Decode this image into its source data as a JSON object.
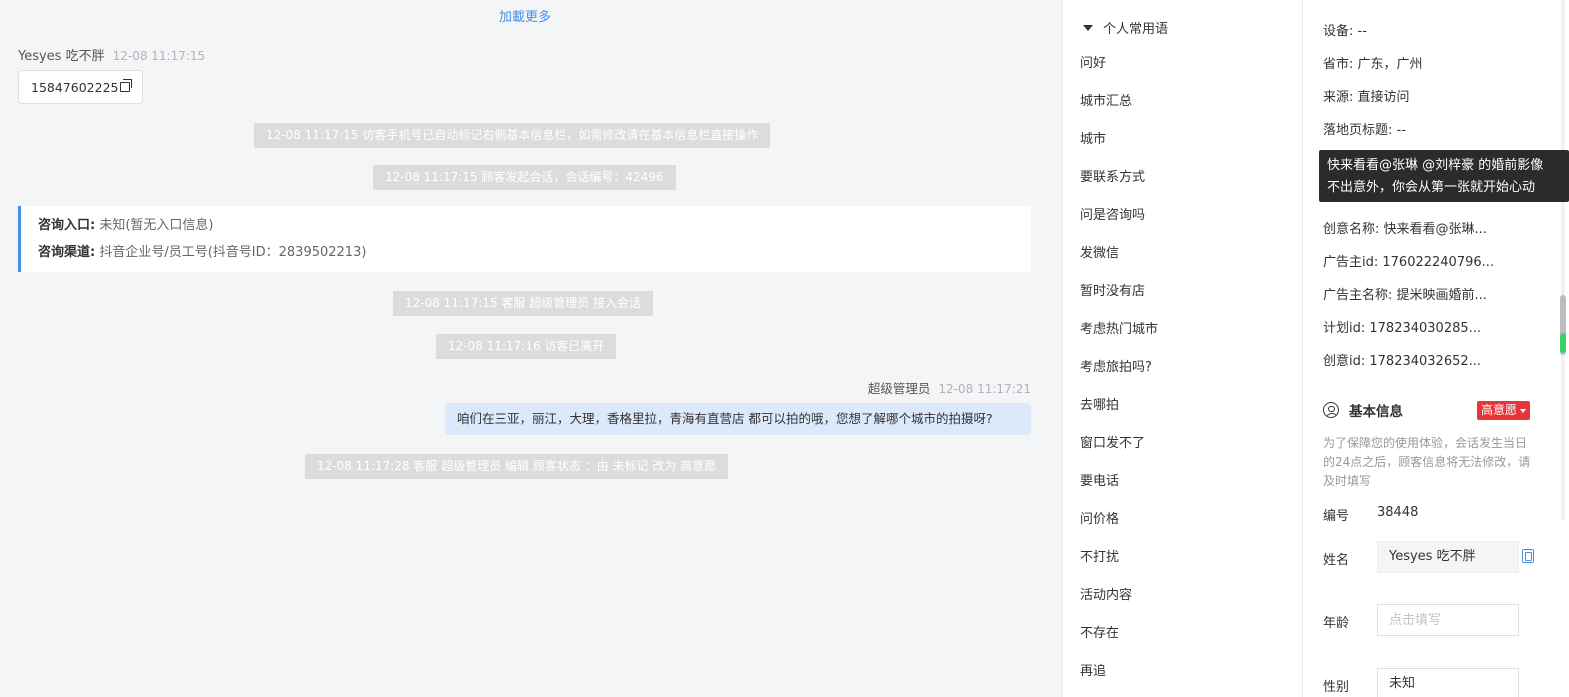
{
  "chat": {
    "load_more": "加載更多",
    "first_msg": {
      "sender": "Yesyes 吃不胖",
      "time": "12-08 11:17:15",
      "content": "15847602225"
    },
    "system_msgs": [
      "12-08 11:17:15 访客手机号已自动标记右侧基本信息栏，如需修改请在基本信息栏直接操作",
      "12-08 11:17:15 顾客发起会话，会话编号：42496",
      "12-08 11:17:15 客服 超级管理员 接入会话",
      "12-08 11:17:16 访客已离开",
      "12-08 11:17:28 客服 超级管理员 编辑 顾客状态 ：由 未标记 改为 高意愿"
    ],
    "consult": {
      "entry_label": "咨询入口:",
      "entry_value": "未知(暂无入口信息)",
      "channel_label": "咨询渠道:",
      "channel_value": "抖音企业号/员工号(抖音号ID：2839502213)"
    },
    "agent_msg": {
      "sender": "超级管理员",
      "time": "12-08 11:17:21",
      "content": "咱们在三亚，丽江，大理，香格里拉，青海有直营店 都可以拍的哦，您想了解哪个城市的拍摄呀?"
    }
  },
  "phrases": {
    "title": "个人常用语",
    "items": [
      "问好",
      "城市汇总",
      "城市",
      "要联系方式",
      "问是咨询吗",
      "发微信",
      "暂时没有店",
      "考虑热门城市",
      "考虑旅拍吗?",
      "去哪拍",
      "窗口发不了",
      "要电话",
      "问价格",
      "不打扰",
      "活动内容",
      "不存在",
      "再追"
    ]
  },
  "info": {
    "device": "设备: --",
    "province": "省市: 广东，广州",
    "source": "来源: 直接访问",
    "landing": "落地页标题: --",
    "creative_name": "创意名称: 快来看看@张琳...",
    "advertiser_id": "广告主id: 176022240796...",
    "advertiser_name": "广告主名称: 提米映画婚前...",
    "plan_id": "计划id: 178234030285...",
    "creative_id": "创意id: 178234032652...",
    "tooltip_line1": "快来看看@张琳 @刘梓豪 的婚前影像",
    "tooltip_line2": "不出意外，你会从第一张就开始心动",
    "section_title": "基本信息",
    "intent_badge": "高意愿",
    "note": "为了保障您的使用体验，会话发生当日的24点之后，顾客信息将无法修改，请及时填写",
    "id_label": "编号",
    "id_value": "38448",
    "name_label": "姓名",
    "name_value": "Yesyes 吃不胖",
    "age_label": "年龄",
    "age_placeholder": "点击填写",
    "gender_label": "性别",
    "gender_value": "未知"
  },
  "colors": {
    "accent": "#4a90e2",
    "badge": "#e8353a",
    "agent_bubble": "#dce9fb",
    "system_msg": "#dcdcdc"
  }
}
